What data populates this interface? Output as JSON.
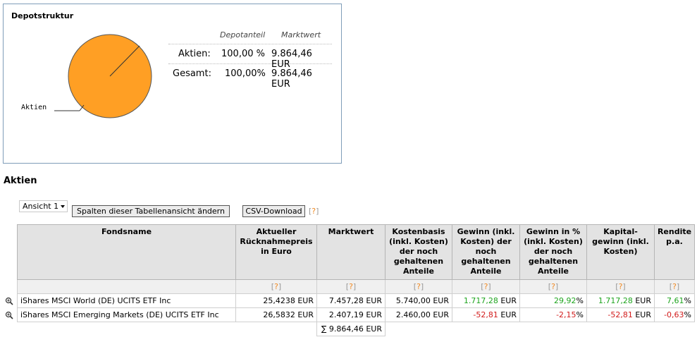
{
  "panel": {
    "title": "Depotstruktur",
    "summary_head": {
      "share": "Depotanteil",
      "value": "Marktwert"
    },
    "summary_rows": [
      {
        "label": "Aktien:",
        "share": "100,00 %",
        "value": "9.864,46 EUR"
      },
      {
        "label": "Gesamt:",
        "share": "100,00%",
        "value": "9.864,46 EUR"
      }
    ]
  },
  "chart_data": {
    "type": "pie",
    "slices": [
      {
        "label": "Aktien",
        "value": 100,
        "color": "#ff9f24"
      }
    ]
  },
  "section_title": "Aktien",
  "controls": {
    "view_select": "Ansicht 1",
    "columns_button": "Spalten dieser Tabellenansicht ändern",
    "csv_button": "CSV-Download",
    "help": "[?]"
  },
  "table": {
    "headers": [
      "Fondsname",
      "Aktueller Rücknahmepreis in Euro",
      "Marktwert",
      "Kostenbasis (inkl. Kosten) der noch gehaltenen Anteile",
      "Gewinn (inkl. Kosten) der noch gehaltenen Anteile",
      "Gewinn in % (inkl. Kosten) der noch gehaltenen Anteile",
      "Kapital-gewinn (inkl. Kosten)",
      "Rendite p.a."
    ],
    "help_row": [
      "",
      "[?]",
      "[?]",
      "[?]",
      "[?]",
      "[?]",
      "[?]",
      "[?]"
    ],
    "rows": [
      {
        "name": "iShares MSCI World (DE) UCITS ETF Inc",
        "price": "25,4238 EUR",
        "market": "7.457,28 EUR",
        "cost": "5.740,00 EUR",
        "gain": "1.717,28",
        "gain_unit": " EUR",
        "gain_pct": "29,92",
        "pct_unit": "%",
        "capgain": "1.717,28",
        "cap_unit": " EUR",
        "yield": "7,61",
        "yield_unit": "%",
        "sign": "pos"
      },
      {
        "name": "iShares MSCI Emerging Markets (DE) UCITS ETF Inc",
        "price": "26,5832 EUR",
        "market": "2.407,19 EUR",
        "cost": "2.460,00 EUR",
        "gain": "-52,81",
        "gain_unit": " EUR",
        "gain_pct": "-2,15",
        "pct_unit": "%",
        "capgain": "-52,81",
        "cap_unit": " EUR",
        "yield": "-0,63",
        "yield_unit": "%",
        "sign": "neg"
      }
    ],
    "total": "∑ 9.864,46 EUR"
  },
  "colors": {
    "positive": "#1fa51f",
    "negative": "#d21c1c",
    "help": "#f08a24"
  }
}
